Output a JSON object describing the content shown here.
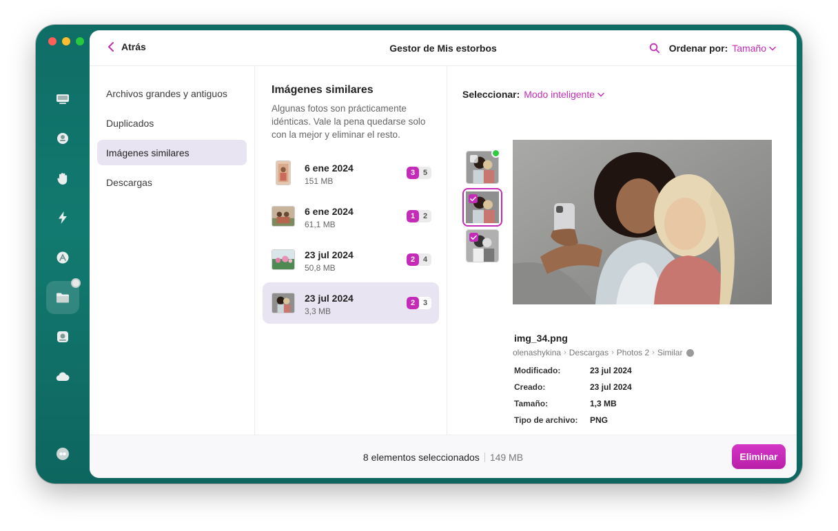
{
  "header": {
    "back_label": "Atrás",
    "title": "Gestor de Mis estorbos",
    "sort_label": "Ordenar por:",
    "sort_value": "Tamaño"
  },
  "categories": [
    {
      "label": "Archivos grandes y antiguos"
    },
    {
      "label": "Duplicados"
    },
    {
      "label": "Imágenes similares",
      "active": true
    },
    {
      "label": "Descargas"
    }
  ],
  "groups_panel": {
    "title": "Imágenes similares",
    "description": "Algunas fotos son prácticamente idénticas. Vale la pena quedarse solo con la mejor y eliminar el resto.",
    "groups": [
      {
        "date": "6 ene 2024",
        "size": "151 MB",
        "selected": "3",
        "total": "5"
      },
      {
        "date": "6 ene 2024",
        "size": "61,1 MB",
        "selected": "1",
        "total": "2"
      },
      {
        "date": "23 jul 2024",
        "size": "50,8 MB",
        "selected": "2",
        "total": "4"
      },
      {
        "date": "23 jul 2024",
        "size": "3,3 MB",
        "selected": "2",
        "total": "3",
        "active": true
      }
    ]
  },
  "detail": {
    "select_label": "Seleccionar:",
    "select_value": "Modo inteligente",
    "file_name": "img_34.png",
    "path": [
      "olenashykina",
      "Descargas",
      "Photos 2",
      "Similar"
    ],
    "meta": [
      {
        "key": "Modificado:",
        "value": "23 jul 2024"
      },
      {
        "key": "Creado:",
        "value": "23 jul 2024"
      },
      {
        "key": "Tamaño:",
        "value": "1,3 MB"
      },
      {
        "key": "Tipo de archivo:",
        "value": "PNG"
      }
    ]
  },
  "footer": {
    "selection_text": "8 elementos seleccionados",
    "selection_size": "149 MB",
    "delete_label": "Eliminar"
  },
  "icons": {
    "sidebar": [
      "disk-icon",
      "privacy-icon",
      "hand-icon",
      "lightning-icon",
      "apps-icon",
      "folder-icon",
      "shredder-icon",
      "cloud-icon",
      "assistant-icon"
    ]
  },
  "colors": {
    "accent": "#c42bb8",
    "sidebar_bg": "#0f6d66",
    "active_bg": "#e8e4f1"
  }
}
